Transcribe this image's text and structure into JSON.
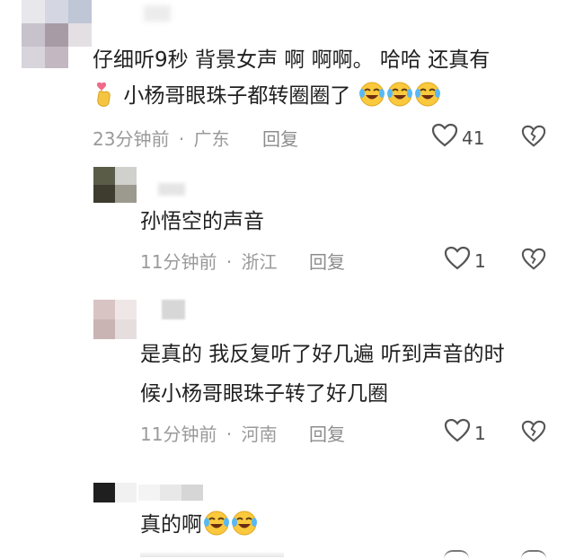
{
  "comments": [
    {
      "text_line1": "仔细听9秒 背景女声 啊 啊啊。 哈哈 还真有",
      "text_line2": "小杨哥眼珠子都转圈圈了",
      "time": "23分钟前",
      "region": "广东",
      "reply": "回复",
      "likes": "41"
    },
    {
      "text_line1": "孙悟空的声音",
      "time": "11分钟前",
      "region": "浙江",
      "reply": "回复",
      "likes": "1"
    },
    {
      "text_line1": "是真的 我反复听了好几遍 听到声音的时",
      "text_line2": "候小杨哥眼珠子转了好几圈",
      "time": "11分钟前",
      "region": "河南",
      "reply": "回复",
      "likes": "1"
    },
    {
      "text_line1": "真的啊"
    }
  ],
  "separator": "·",
  "icons": {
    "heart": "heart-icon",
    "broken_heart": "broken-heart-icon",
    "emoji": "laughing-crying-emoji",
    "finger_heart": "finger-heart-emoji"
  }
}
